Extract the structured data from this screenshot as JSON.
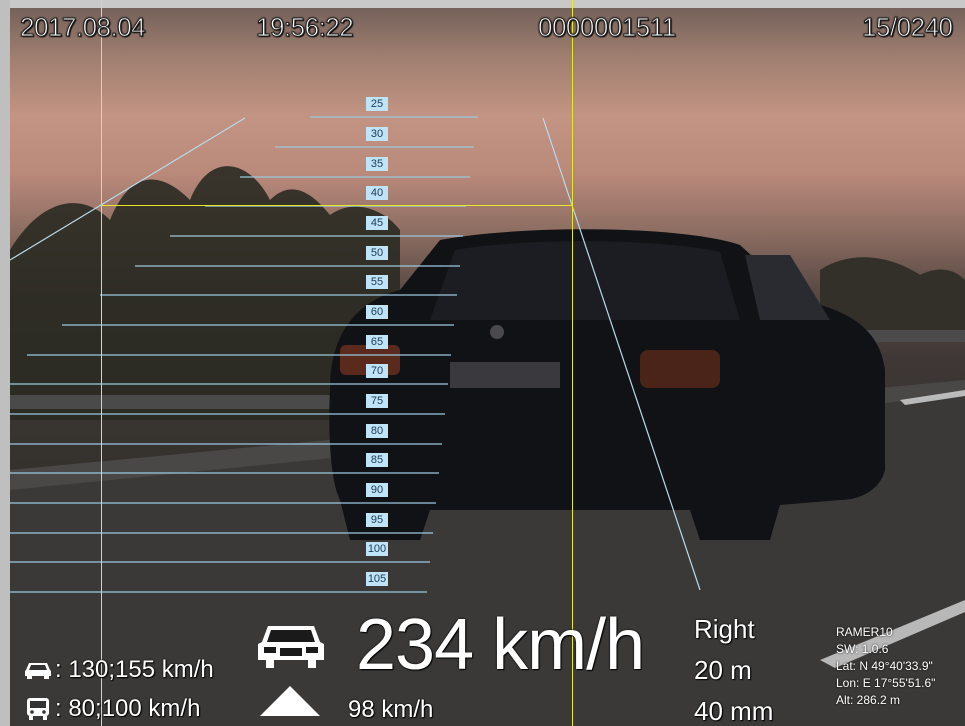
{
  "header": {
    "date": "2017.08.04",
    "time": "19:56:22",
    "record_id": "0000001511",
    "frame_counter": "15/0240"
  },
  "speed_grid": {
    "labels": [
      "25",
      "30",
      "35",
      "40",
      "45",
      "50",
      "55",
      "60",
      "65",
      "70",
      "75",
      "80",
      "85",
      "90",
      "95",
      "100",
      "105"
    ]
  },
  "measurement": {
    "speed": "234 km/h",
    "limit_speed": "98 km/h",
    "direction": "Right",
    "distance": "20 m",
    "lens": "40 mm"
  },
  "limits": {
    "car": ": 130;155 km/h",
    "bus": ": 80;100 km/h"
  },
  "device": {
    "name": "RAMER10",
    "sw": "SW: 1.0.6",
    "lat": "Lat: N 49°40'33.9\"",
    "lon": "Lon: E 17°55'51.6\"",
    "alt": "Alt: 286.2 m"
  },
  "icons": {
    "car": "car-front-icon",
    "arrow": "triangle-up-icon",
    "car_small": "car-icon",
    "bus": "bus-icon"
  },
  "colors": {
    "guide_lines": "#e6e62a",
    "grid_lines": "#9cc8e0",
    "grid_label_bg": "#bfe3f7"
  }
}
